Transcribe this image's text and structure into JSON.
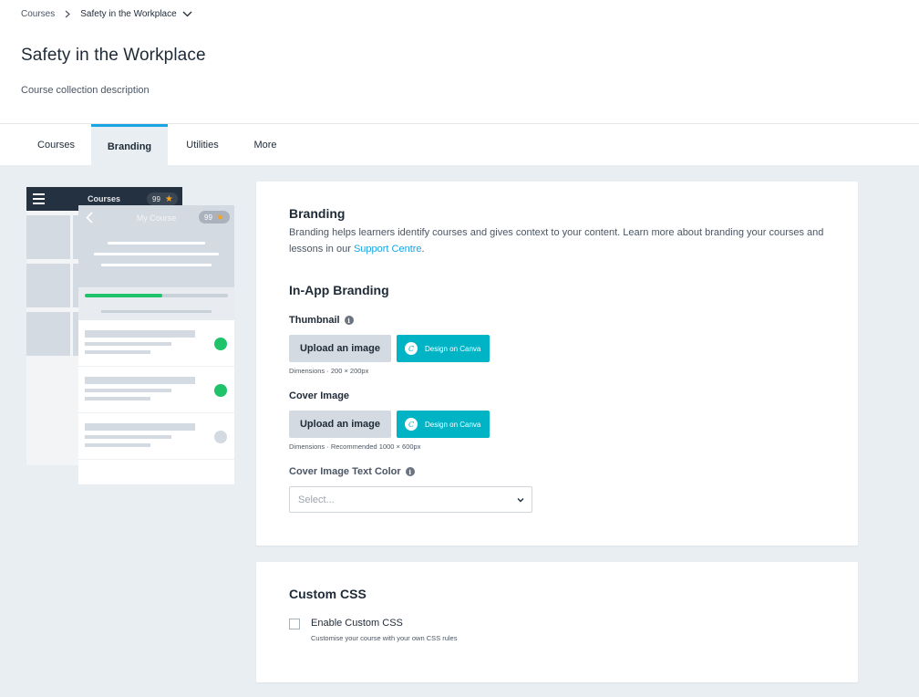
{
  "breadcrumb": {
    "root": "Courses",
    "current": "Safety in the Workplace"
  },
  "page": {
    "title": "Safety in the Workplace",
    "description": "Course collection description"
  },
  "tabs": [
    {
      "label": "Courses",
      "active": false
    },
    {
      "label": "Branding",
      "active": true
    },
    {
      "label": "Utilities",
      "active": false
    },
    {
      "label": "More",
      "active": false
    }
  ],
  "preview": {
    "back_title": "Courses",
    "back_count": "99",
    "front_title": "My Course",
    "front_count": "99",
    "progress": 0.54,
    "lesson_status": [
      "complete",
      "complete",
      "incomplete"
    ]
  },
  "branding": {
    "heading": "Branding",
    "intro_text": "Branding helps learners identify courses and gives context to your content. Learn more about branding your courses and lessons in our ",
    "intro_link": "Support Centre",
    "intro_end": ".",
    "in_app_heading": "In-App Branding",
    "thumbnail": {
      "label": "Thumbnail",
      "upload_label": "Upload an image",
      "canva_label": "Design on Canva",
      "hint": "Dimensions · 200 × 200px"
    },
    "cover": {
      "label": "Cover Image",
      "upload_label": "Upload an image",
      "canva_label": "Design on Canva",
      "hint": "Dimensions · Recommended 1000 × 600px"
    },
    "text_color": {
      "label": "Cover Image Text Color",
      "placeholder": "Select..."
    }
  },
  "custom_css": {
    "heading": "Custom CSS",
    "checkbox_label": "Enable Custom CSS",
    "checkbox_help": "Customise your course with your own CSS rules",
    "checked": false
  },
  "colors": {
    "accent": "#19a5e3",
    "canva": "#00b4c6",
    "success": "#1fc36a",
    "star": "#f7a21b",
    "dark_bar": "#243140"
  },
  "icons": {
    "breadcrumb_separator": "chevron-right-icon",
    "breadcrumb_dropdown": "chevron-down-icon",
    "info": "info-icon",
    "canva": "canva-logo-icon",
    "select": "chevron-down-icon",
    "menu": "hamburger-icon",
    "star": "star-icon",
    "back": "chevron-left-icon"
  }
}
